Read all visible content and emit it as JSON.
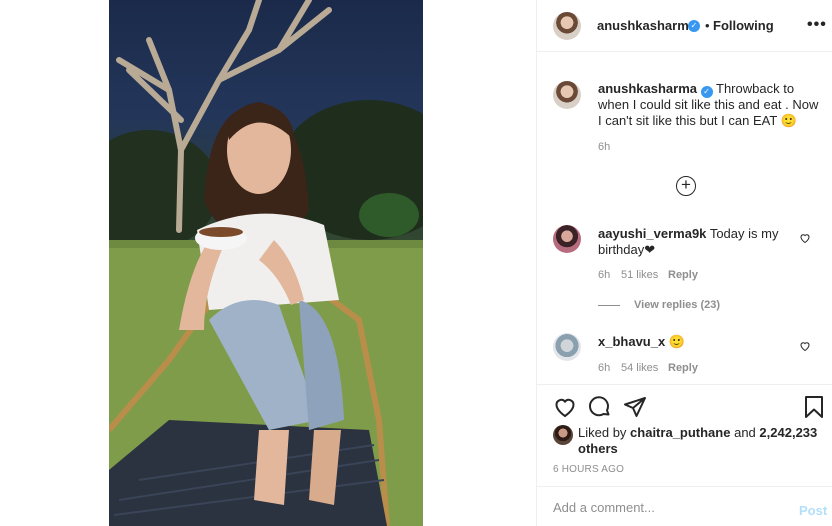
{
  "post": {
    "author": "anushkasharma",
    "follow_separator": "•",
    "follow_status": "Following",
    "more_label": "•••",
    "caption": {
      "username": "anushkasharma",
      "text": "Throwback to when I could sit like this and eat . Now I can't sit like this but I can EAT 🙂",
      "time": "6h"
    },
    "load_more_icon": "plus-circle-icon",
    "comments": [
      {
        "username": "aayushi_verma9k",
        "text": "Today is my birthday❤",
        "time": "6h",
        "likes": "51 likes",
        "reply": "Reply",
        "view_replies": "View replies (23)"
      },
      {
        "username": "x_bhavu_x",
        "text": "🙂",
        "time": "6h",
        "likes": "54 likes",
        "reply": "Reply"
      }
    ],
    "liked_by_prefix": "Liked by",
    "liked_by_user": "chaitra_puthane",
    "liked_by_and": "and",
    "liked_by_others": "2,242,233 others",
    "timestamp": "6 HOURS AGO",
    "comment_placeholder": "Add a comment...",
    "post_label": "Post"
  },
  "colors": {
    "verified": "#3897f0",
    "post_disabled": "#b2dffc",
    "muted": "#8e8e8e",
    "text": "#262626"
  }
}
